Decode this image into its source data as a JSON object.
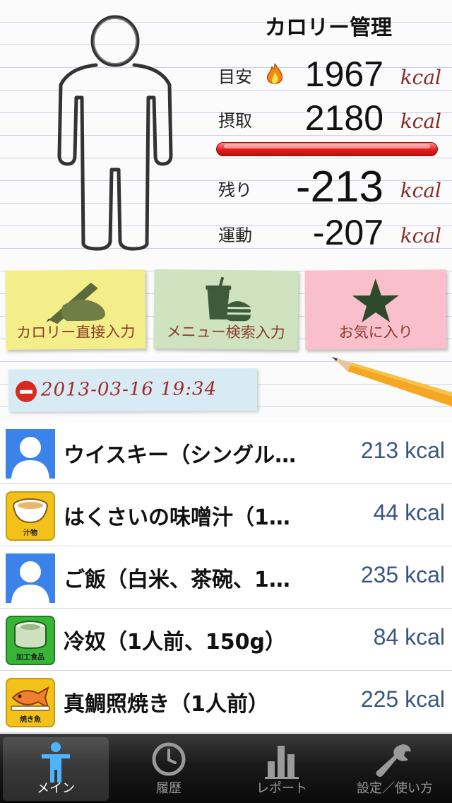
{
  "app": {
    "title": "カロリー管理"
  },
  "stats": {
    "target": {
      "label": "目安",
      "value": "1967",
      "unit": "kcal"
    },
    "intake": {
      "label": "摂取",
      "value": "2180",
      "unit": "kcal"
    },
    "remaining": {
      "label": "残り",
      "value": "-213",
      "unit": "kcal"
    },
    "exercise": {
      "label": "運動",
      "value": "-207",
      "unit": "kcal"
    },
    "progress_ratio": 1.0,
    "progress_color": "#e51c1c"
  },
  "actions": {
    "direct_input": {
      "label": "カロリー直接入力",
      "icon": "hand-writing-icon"
    },
    "menu_search": {
      "label": "メニュー検索入力",
      "icon": "drink-burger-icon"
    },
    "favorites": {
      "label": "お気に入り",
      "icon": "star-icon"
    }
  },
  "date_tag": {
    "text": "2013-03-16 19:34",
    "icon": "delete-minus-icon"
  },
  "entries": [
    {
      "name": "ウイスキー（シングル…",
      "kcal": "213 kcal",
      "thumb": "person-icon"
    },
    {
      "name": "はくさいの味噌汁（1…",
      "kcal": "44 kcal",
      "thumb": "soup-bowl-icon",
      "caption": "汁物"
    },
    {
      "name": "ご飯（白米、茶碗、1…",
      "kcal": "235 kcal",
      "thumb": "person-icon"
    },
    {
      "name": "冷奴（1人前、150g）",
      "kcal": "84 kcal",
      "thumb": "can-icon",
      "caption": "加工食品"
    },
    {
      "name": "真鯛照焼き（1人前）",
      "kcal": "225 kcal",
      "thumb": "grilled-fish-icon",
      "caption": "焼き魚"
    }
  ],
  "tabs": [
    {
      "label": "メイン",
      "icon": "person-icon",
      "active": true
    },
    {
      "label": "履歴",
      "icon": "clock-icon",
      "active": false
    },
    {
      "label": "レポート",
      "icon": "bar-chart-icon",
      "active": false
    },
    {
      "label": "設定／使い方",
      "icon": "wrench-icon",
      "active": false
    }
  ],
  "colors": {
    "kcal_unit": "#8a2a2a",
    "list_kcal": "#3a5682",
    "date_text": "#a12a2a"
  }
}
